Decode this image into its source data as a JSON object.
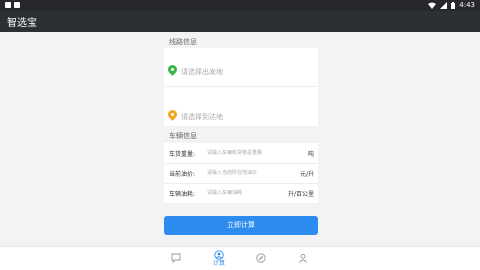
{
  "status_bar": {
    "time": "4:43",
    "icons": [
      "notification-icon",
      "a-icon",
      "wifi-icon",
      "cellular-icon",
      "battery-icon"
    ]
  },
  "app_bar": {
    "title": "智选宝"
  },
  "route_section": {
    "label": "线路信息",
    "origin_placeholder": "请选择出发地",
    "destination_placeholder": "请选择到达地",
    "origin_pin_color": "#3bb54a",
    "destination_pin_color": "#f5a623"
  },
  "vehicle_section": {
    "label": "车辆信息",
    "fields": [
      {
        "label": "车货重量:",
        "placeholder": "请输入车辆和货物总重量",
        "unit": "吨"
      },
      {
        "label": "当前油价:",
        "placeholder": "请输入当前所在地油价",
        "unit": "元/升"
      },
      {
        "label": "车辆油耗:",
        "placeholder": "请输入车辆油耗",
        "unit": "升/百公里"
      }
    ]
  },
  "calculate_button": {
    "label": "立即计算",
    "color": "#2d8cf0"
  },
  "tab_bar": {
    "active_color": "#2d8cf0",
    "tabs": [
      {
        "icon": "chat-icon",
        "label": ""
      },
      {
        "icon": "calculator-icon",
        "label": "计算",
        "active": true
      },
      {
        "icon": "compass-icon",
        "label": ""
      },
      {
        "icon": "user-icon",
        "label": ""
      }
    ]
  }
}
